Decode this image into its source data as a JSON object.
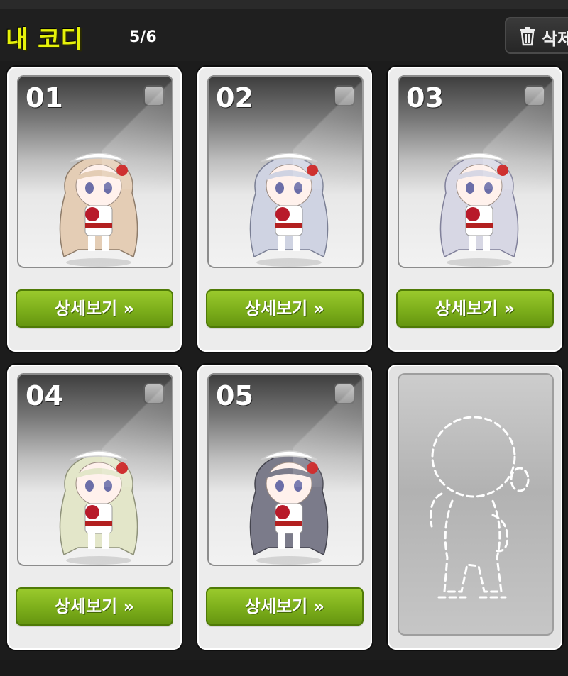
{
  "header": {
    "title": "내 코디",
    "count": "5/6",
    "delete_label": "삭제"
  },
  "slots": [
    {
      "number": "01",
      "button": "상세보기 »",
      "hair_color": "#e4cdb5"
    },
    {
      "number": "02",
      "button": "상세보기 »",
      "hair_color": "#cfd3e2"
    },
    {
      "number": "03",
      "button": "상세보기 »",
      "hair_color": "#d7d7e4"
    },
    {
      "number": "04",
      "button": "상세보기 »",
      "hair_color": "#e3e6c9"
    },
    {
      "number": "05",
      "button": "상세보기 »",
      "hair_color": "#7b7b8a"
    }
  ],
  "empty_slot": {
    "icon": "empty-body-outline-icon"
  },
  "colors": {
    "title": "#e6f20a",
    "button_green": "#7fb11c",
    "background": "#1c1c1c"
  }
}
